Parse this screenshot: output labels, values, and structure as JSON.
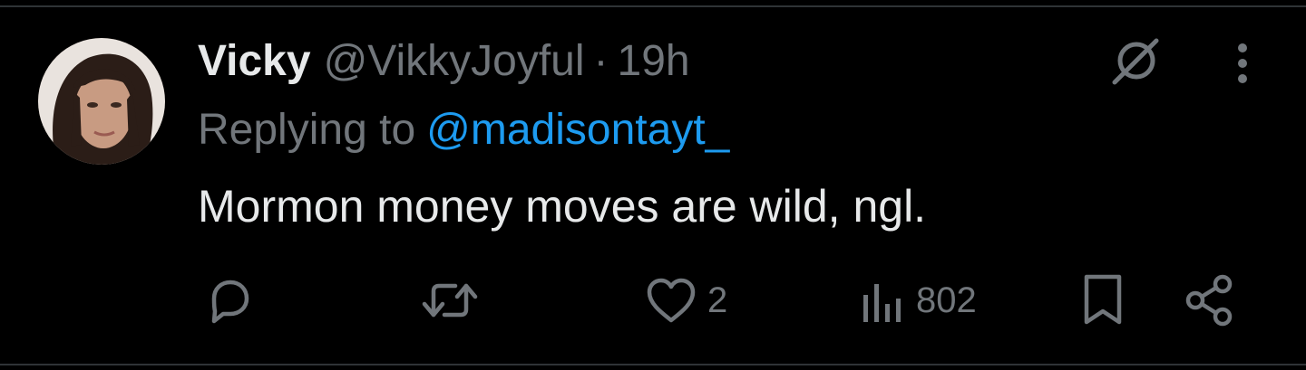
{
  "tweet": {
    "display_name": "Vicky",
    "handle": "@VikkyJoyful",
    "separator": "·",
    "time": "19h",
    "replying_label": "Replying to",
    "reply_to_handle": "@madisontayt_",
    "text": "Mormon money moves are wild, ngl."
  },
  "actions": {
    "reply": {
      "icon": "reply-icon",
      "count": ""
    },
    "repost": {
      "icon": "repost-icon",
      "count": ""
    },
    "like": {
      "icon": "heart-icon",
      "count": "2"
    },
    "views": {
      "icon": "views-icon",
      "count": "802"
    },
    "bookmark": {
      "icon": "bookmark-icon"
    },
    "share": {
      "icon": "share-icon"
    }
  },
  "header_icons": {
    "grok": "grok-icon",
    "more": "more-options-icon"
  },
  "colors": {
    "background": "#000000",
    "text_primary": "#e7e9ea",
    "text_secondary": "#71767b",
    "accent": "#1d9bf0",
    "divider": "#2f3336"
  }
}
